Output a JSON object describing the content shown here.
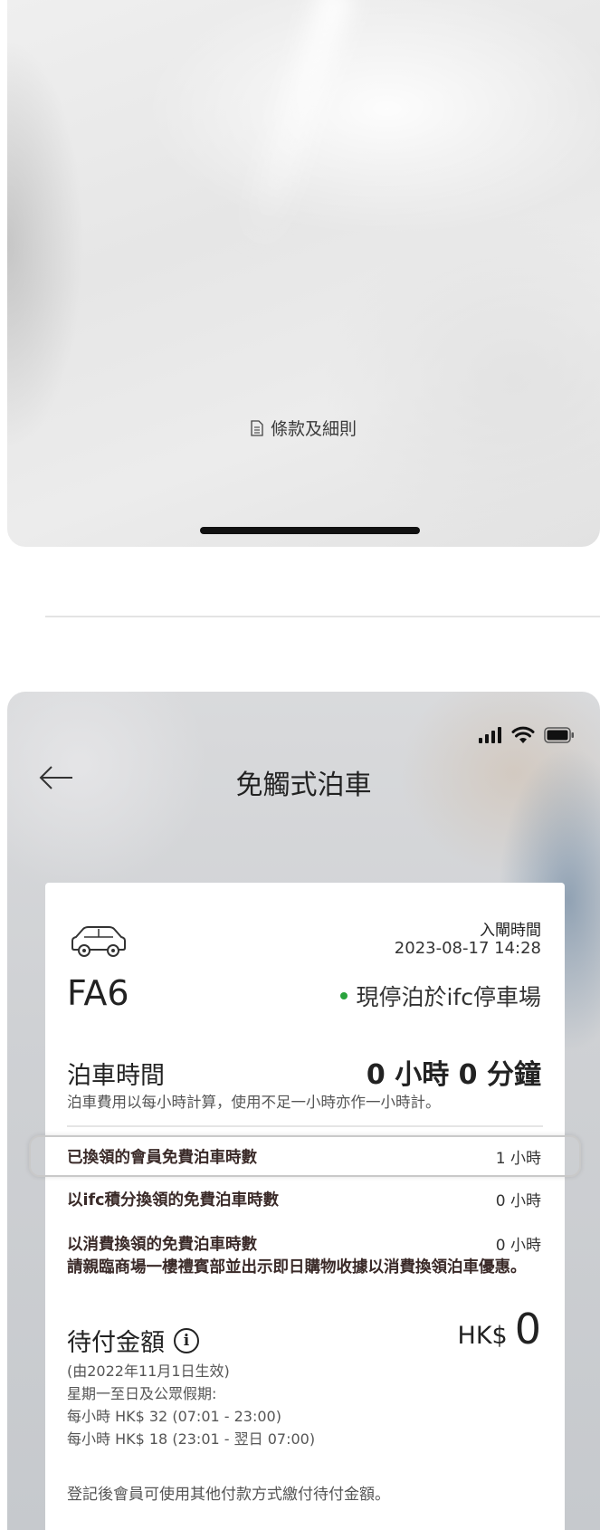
{
  "top_panel": {
    "terms_link": "條款及細則"
  },
  "bottom_panel": {
    "nav_title": "免觸式泊車",
    "card": {
      "entry_label": "入閘時間",
      "entry_time": "2023-08-17 14:28",
      "plate": "FA6",
      "parked_status": "現停泊於ifc停車場",
      "parking_time_label": "泊車時間",
      "parking_time_value": "0 小時 0 分鐘",
      "parking_time_note": "泊車費用以每小時計算，使用不足一小時亦作一小時計。",
      "rows": [
        {
          "label": "已換領的會員免費泊車時數",
          "value": "1 小時"
        },
        {
          "label": "以ifc積分換領的免費泊車時數",
          "value": "0 小時"
        },
        {
          "label": "以消費換領的免費泊車時數",
          "value": "0 小時"
        }
      ],
      "consume_note": "請親臨商場一樓禮賓部並出示即日購物收據以消費換領泊車優惠。",
      "payable_label": "待付金額",
      "payable_currency": "HK$",
      "payable_value": "0",
      "rate_lines": [
        "(由2022年11月1日生效)",
        "星期一至日及公眾假期:",
        "每小時 HK$ 32 (07:01 - 23:00)",
        "每小時 HK$ 18 (23:01 - 翌日 07:00)"
      ],
      "footer_note": "登記後會員可使用其他付款方式繳付待付金額。"
    }
  },
  "colors": {
    "status_green": "#29a33d",
    "highlight_border": "#c9c9c9"
  }
}
